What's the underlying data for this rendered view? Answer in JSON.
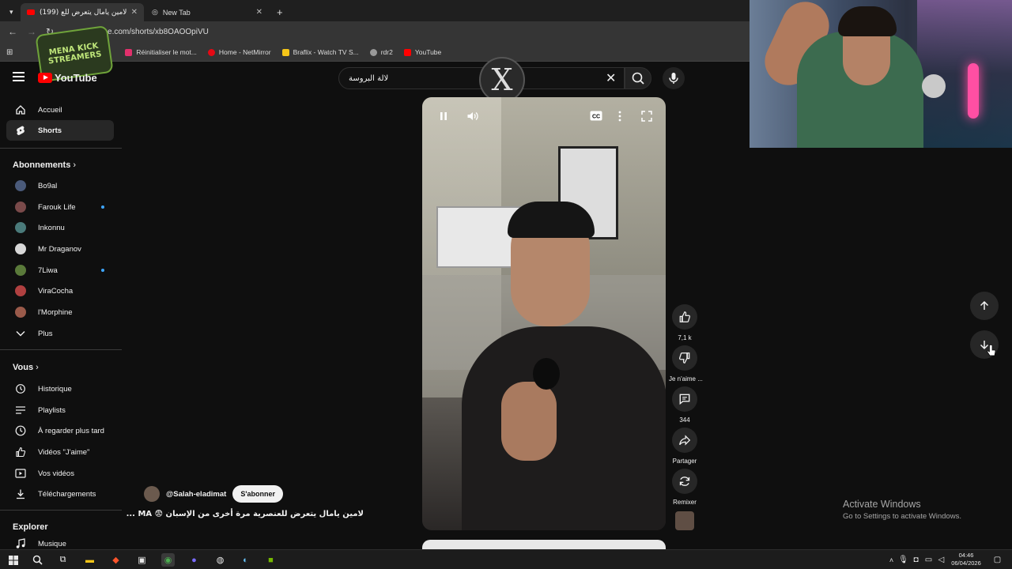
{
  "browser": {
    "tabs": [
      {
        "title": "(199) لامين يامال يتعرض للع",
        "active": true
      },
      {
        "title": "New Tab",
        "active": false
      }
    ],
    "url": "youtube.com/shorts/xb8OAOOpiVU",
    "bookmarks": [
      {
        "label": "Réinitialiser le mot...",
        "icon": "instagram-icon",
        "color": "#e1306c"
      },
      {
        "label": "Home - NetMirror",
        "icon": "heart-icon",
        "color": "#e50914"
      },
      {
        "label": "Braflix - Watch TV S...",
        "icon": "gift-icon",
        "color": "#f5c518"
      },
      {
        "label": "rdr2",
        "icon": "globe-icon",
        "color": "#999999"
      },
      {
        "label": "YouTube",
        "icon": "youtube-icon",
        "color": "#ff0000"
      }
    ]
  },
  "overlay_logo": {
    "line1": "MENA KICK",
    "line2": "STREAMERS"
  },
  "youtube": {
    "logo_text": "YouTube",
    "search": {
      "value": "لالة البروسة"
    },
    "sidebar": {
      "main": [
        {
          "label": "Accueil",
          "icon": "home-icon",
          "active": false
        },
        {
          "label": "Shorts",
          "icon": "shorts-icon",
          "active": true
        }
      ],
      "subscriptions_title": "Abonnements",
      "subscriptions": [
        {
          "label": "Bo9al",
          "dot": false,
          "color": "#4a5a7a"
        },
        {
          "label": "Farouk Life",
          "dot": true,
          "color": "#7a4a4a"
        },
        {
          "label": "Inkonnu",
          "dot": false,
          "color": "#4a7a7a"
        },
        {
          "label": "Mr Draganov",
          "dot": false,
          "color": "#d8d8d8"
        },
        {
          "label": "7Liwa",
          "dot": true,
          "color": "#5a7a3a"
        },
        {
          "label": "ViraCocha",
          "dot": false,
          "color": "#b04040"
        },
        {
          "label": "l'Morphine",
          "dot": false,
          "color": "#9a5a4a"
        },
        {
          "label": "Plus",
          "dot": false,
          "color": ""
        }
      ],
      "you_title": "Vous",
      "you": [
        {
          "label": "Historique",
          "icon": "history-icon"
        },
        {
          "label": "Playlists",
          "icon": "playlist-icon"
        },
        {
          "label": "À regarder plus tard",
          "icon": "clock-icon"
        },
        {
          "label": "Vidéos \"J'aime\"",
          "icon": "thumb-up-icon"
        },
        {
          "label": "Vos vidéos",
          "icon": "video-icon"
        },
        {
          "label": "Téléchargements",
          "icon": "download-icon"
        }
      ],
      "explore_title": "Explorer",
      "explore": [
        {
          "label": "Musique",
          "icon": "music-icon"
        }
      ]
    },
    "short": {
      "channel": "@Salah-eladimat",
      "subscribe_label": "S'abonner",
      "title": "لامين يامال يتعرض للعنصرية مرة أخرى من الإسبان 😨 MA ...",
      "actions": {
        "like_count": "7,1 k",
        "dislike_label": "Je n'aime ...",
        "comments_count": "344",
        "share_label": "Partager",
        "remix_label": "Remixer"
      }
    }
  },
  "windows": {
    "watermark_title": "Activate Windows",
    "watermark_subtitle": "Go to Settings to activate Windows.",
    "time": "04:46",
    "date": "06/04/2026"
  }
}
